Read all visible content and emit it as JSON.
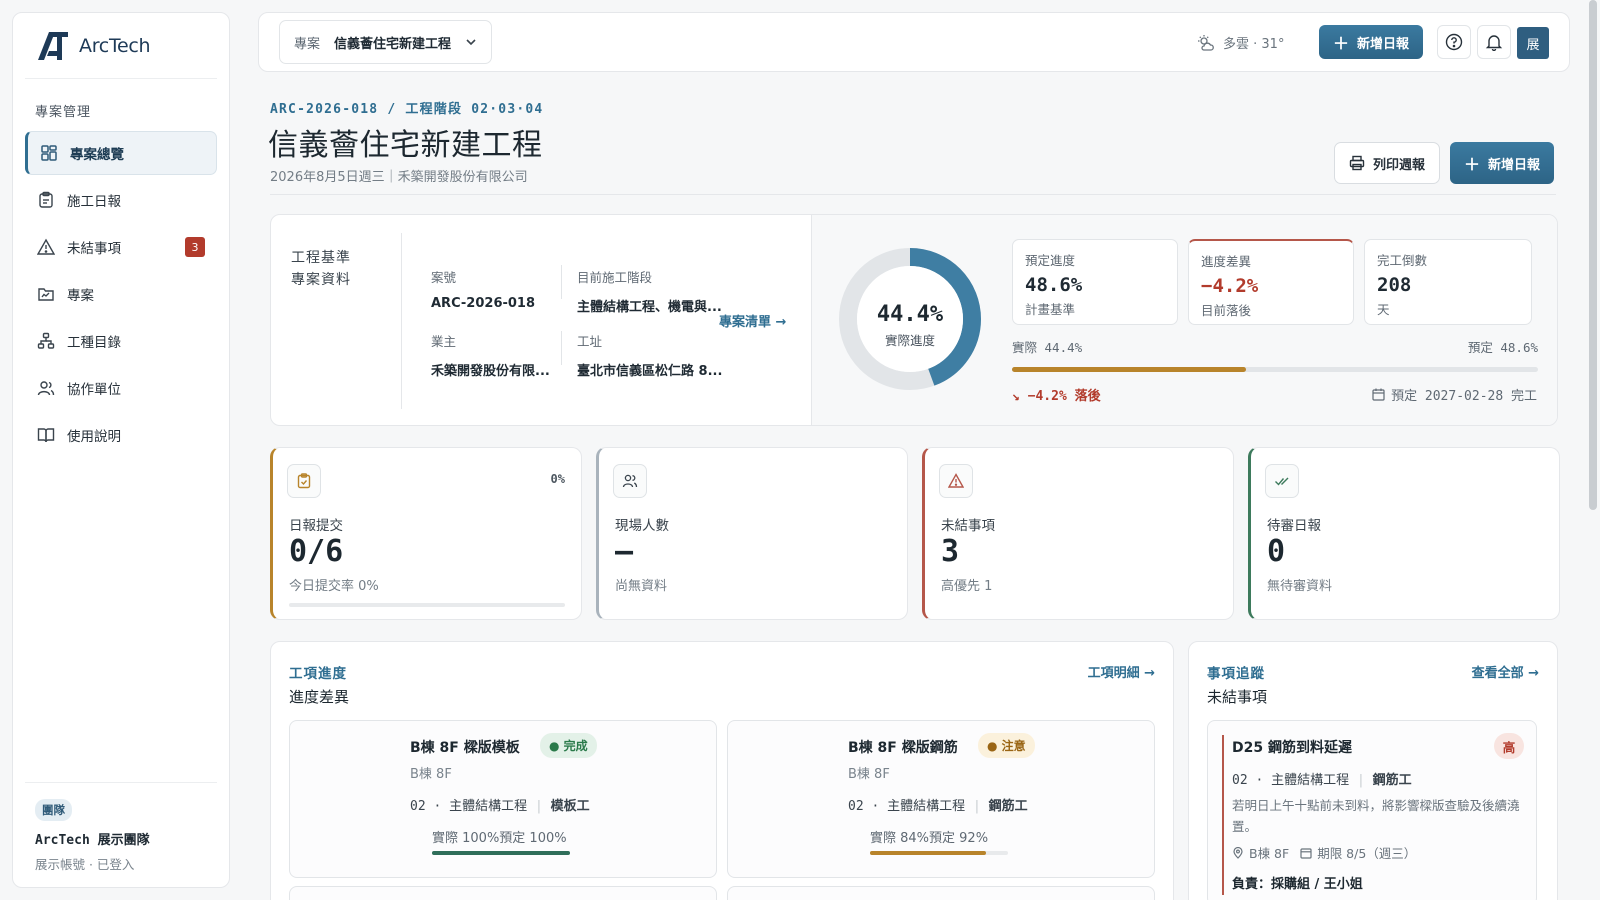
{
  "brand": {
    "name": "ArcTech",
    "accent": "#2f6e91"
  },
  "sidebar": {
    "section": "專案管理",
    "items": [
      {
        "label": "專案總覽",
        "icon": "dashboard-icon"
      },
      {
        "label": "施工日報",
        "icon": "clipboard-icon"
      },
      {
        "label": "未結事項",
        "icon": "warning-icon",
        "badge": "3"
      },
      {
        "label": "專案",
        "icon": "folder-icon"
      },
      {
        "label": "工種目錄",
        "icon": "hierarchy-icon"
      },
      {
        "label": "協作單位",
        "icon": "users-icon"
      },
      {
        "label": "使用說明",
        "icon": "book-icon"
      }
    ],
    "team_tag": "團隊",
    "team_name": "ArcTech 展示團隊",
    "account_status": "展示帳號 · 已登入"
  },
  "topbar": {
    "project_label": "專案",
    "project_value": "信義薈住宅新建工程",
    "weather": "多雲 · 31°",
    "new_log": "新增日報",
    "avatar": "展"
  },
  "header": {
    "breadcrumb": "ARC-2026-018 / 工程階段 02·03·04",
    "title": "信義薈住宅新建工程",
    "subtitle": "2026年8月5日週三｜禾築開發股份有限公司",
    "print_button": "列印週報",
    "new_button": "新增日報"
  },
  "overview": {
    "heading_1": "工程基準",
    "heading_2": "專案資料",
    "case_no_label": "案號",
    "case_no": "ARC-2026-018",
    "phase_label": "目前施工階段",
    "phase": "主體結構工程、機電與...",
    "owner_label": "業主",
    "owner": "禾築開發股份有限...",
    "site_label": "工址",
    "site": "臺北市信義區松仁路 8...",
    "project_list_link": "專案清單 →",
    "actual_percent": 44.4,
    "actual_display": "44.4%",
    "actual_label": "實際進度",
    "planned": {
      "label": "預定進度",
      "value": "48.6%",
      "sub": "計畫基準"
    },
    "variance": {
      "label": "進度差異",
      "value": "−4.2%",
      "sub": "目前落後"
    },
    "countdown": {
      "label": "完工倒數",
      "value": "208",
      "sub": "天"
    },
    "bar_actual": "實際 44.4%",
    "bar_planned": "預定 48.6%",
    "behind": "↘ −4.2% 落後",
    "due": "預定 2027-02-28 完工"
  },
  "kpis": [
    {
      "label": "日報提交",
      "value": "0/6",
      "sub": "今日提交率 0%",
      "pct": "0%",
      "icon": "clipboard-check-icon",
      "color": "#b8842b"
    },
    {
      "label": "現場人數",
      "value": "–",
      "sub": "尚無資料",
      "icon": "users-icon",
      "color": "#a9b3bc"
    },
    {
      "label": "未結事項",
      "value": "3",
      "sub": "高優先 1",
      "icon": "warning-icon",
      "color": "#b5574a"
    },
    {
      "label": "待審日報",
      "value": "0",
      "sub": "無待審資料",
      "icon": "double-check-icon",
      "color": "#3d7a5c"
    }
  ],
  "work_progress": {
    "eyebrow": "工項進度",
    "title": "進度差異",
    "link": "工項明細 →",
    "tasks": [
      {
        "name": "B棟 8F 樑版模板",
        "status": "● 完成",
        "floor": "B棟 8F",
        "meta_prefix": "02 · 主體結構工程",
        "trade": "模板工",
        "progress_text": "實際 100%預定 100%",
        "actual": 1.0,
        "color": "#2f6e5a"
      },
      {
        "name": "B棟 8F 樑版鋼筋",
        "status": "● 注意",
        "floor": "B棟 8F",
        "meta_prefix": "02 · 主體結構工程",
        "trade": "鋼筋工",
        "progress_text": "實際 84%預定 92%",
        "actual": 0.84,
        "color": "#b8842b"
      }
    ]
  },
  "issues": {
    "eyebrow": "事項追蹤",
    "title": "未結事項",
    "link": "查看全部 →",
    "item": {
      "title": "D25 鋼筋到料延遲",
      "priority": "高",
      "meta_prefix": "02 · 主體結構工程",
      "trade": "鋼筋工",
      "desc": "若明日上午十點前未到料，將影響樑版查驗及後續澆置。",
      "location": "B棟 8F",
      "deadline": "期限 8/5（週三）",
      "owner": "負責：採購組 / 王小姐"
    }
  }
}
